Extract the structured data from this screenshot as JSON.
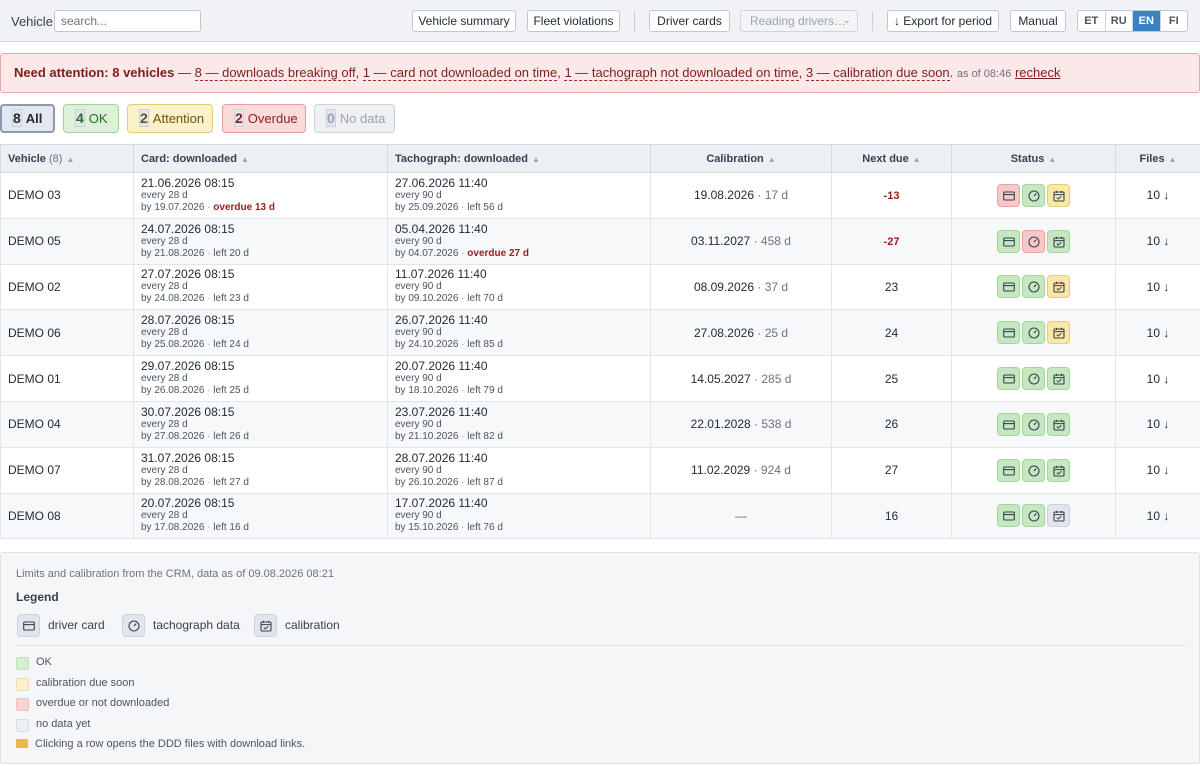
{
  "toolbar": {
    "vehicle_label": "Vehicle:",
    "search_placeholder": "search...",
    "vehicle_summary": "Vehicle summary",
    "fleet_violations": "Fleet violations",
    "driver_cards": "Driver cards",
    "reading_drivers": "Reading drivers…",
    "export": "↓ Export for period",
    "manual": "Manual",
    "languages": [
      {
        "code": "ET",
        "active": false
      },
      {
        "code": "RU",
        "active": false
      },
      {
        "code": "EN",
        "active": true
      },
      {
        "code": "FI",
        "active": false
      }
    ]
  },
  "alert": {
    "title": "Need attention: 8 vehicles",
    "dash": "—",
    "item1": "8 — downloads breaking off",
    "item2": "1 — card not downloaded on time",
    "item3": "1 — tachograph not downloaded on time",
    "item4": "3 — calibration due soon",
    "asof": "as of 08:46",
    "recheck": "recheck"
  },
  "filters": [
    {
      "count": "8",
      "label": "All",
      "kind": "all"
    },
    {
      "count": "4",
      "label": "OK",
      "kind": "ok"
    },
    {
      "count": "2",
      "label": "Attention",
      "kind": "attention"
    },
    {
      "count": "2",
      "label": "Overdue",
      "kind": "overdue"
    },
    {
      "count": "0",
      "label": "No data",
      "kind": "nodata"
    }
  ],
  "table": {
    "headers": {
      "vehicle": "Vehicle",
      "vehicle_count": "(8)",
      "card": "Card: downloaded",
      "tacho": "Tachograph: downloaded",
      "calibration": "Calibration",
      "next_due": "Next due",
      "status": "Status",
      "files": "Files"
    },
    "rows": [
      {
        "vehicle": "DEMO 03",
        "card": {
          "date": "21.06.2026 08:15",
          "every": "every 28 d",
          "by": "by 19.07.2026",
          "extra": "overdue 13 d",
          "overdue": true
        },
        "tacho": {
          "date": "27.06.2026 11:40",
          "every": "every 90 d",
          "by": "by 25.09.2026",
          "extra": "left 56 d",
          "overdue": false
        },
        "cal_date": "19.08.2026",
        "cal_days": "17 d",
        "next_due": "-13",
        "neg": true,
        "status": [
          "r",
          "g",
          "y"
        ],
        "files": "10 ↓"
      },
      {
        "vehicle": "DEMO 05",
        "card": {
          "date": "24.07.2026 08:15",
          "every": "every 28 d",
          "by": "by 21.08.2026",
          "extra": "left 20 d",
          "overdue": false
        },
        "tacho": {
          "date": "05.04.2026 11:40",
          "every": "every 90 d",
          "by": "by 04.07.2026",
          "extra": "overdue 27 d",
          "overdue": true
        },
        "cal_date": "03.11.2027",
        "cal_days": "458 d",
        "next_due": "-27",
        "neg": true,
        "status": [
          "g",
          "r",
          "g"
        ],
        "files": "10 ↓"
      },
      {
        "vehicle": "DEMO 02",
        "card": {
          "date": "27.07.2026 08:15",
          "every": "every 28 d",
          "by": "by 24.08.2026",
          "extra": "left 23 d",
          "overdue": false
        },
        "tacho": {
          "date": "11.07.2026 11:40",
          "every": "every 90 d",
          "by": "by 09.10.2026",
          "extra": "left 70 d",
          "overdue": false
        },
        "cal_date": "08.09.2026",
        "cal_days": "37 d",
        "next_due": "23",
        "neg": false,
        "status": [
          "g",
          "g",
          "y"
        ],
        "files": "10 ↓"
      },
      {
        "vehicle": "DEMO 06",
        "card": {
          "date": "28.07.2026 08:15",
          "every": "every 28 d",
          "by": "by 25.08.2026",
          "extra": "left 24 d",
          "overdue": false
        },
        "tacho": {
          "date": "26.07.2026 11:40",
          "every": "every 90 d",
          "by": "by 24.10.2026",
          "extra": "left 85 d",
          "overdue": false
        },
        "cal_date": "27.08.2026",
        "cal_days": "25 d",
        "next_due": "24",
        "neg": false,
        "status": [
          "g",
          "g",
          "y"
        ],
        "files": "10 ↓"
      },
      {
        "vehicle": "DEMO 01",
        "card": {
          "date": "29.07.2026 08:15",
          "every": "every 28 d",
          "by": "by 26.08.2026",
          "extra": "left 25 d",
          "overdue": false
        },
        "tacho": {
          "date": "20.07.2026 11:40",
          "every": "every 90 d",
          "by": "by 18.10.2026",
          "extra": "left 79 d",
          "overdue": false
        },
        "cal_date": "14.05.2027",
        "cal_days": "285 d",
        "next_due": "25",
        "neg": false,
        "status": [
          "g",
          "g",
          "g"
        ],
        "files": "10 ↓"
      },
      {
        "vehicle": "DEMO 04",
        "card": {
          "date": "30.07.2026 08:15",
          "every": "every 28 d",
          "by": "by 27.08.2026",
          "extra": "left 26 d",
          "overdue": false
        },
        "tacho": {
          "date": "23.07.2026 11:40",
          "every": "every 90 d",
          "by": "by 21.10.2026",
          "extra": "left 82 d",
          "overdue": false
        },
        "cal_date": "22.01.2028",
        "cal_days": "538 d",
        "next_due": "26",
        "neg": false,
        "status": [
          "g",
          "g",
          "g"
        ],
        "files": "10 ↓"
      },
      {
        "vehicle": "DEMO 07",
        "card": {
          "date": "31.07.2026 08:15",
          "every": "every 28 d",
          "by": "by 28.08.2026",
          "extra": "left 27 d",
          "overdue": false
        },
        "tacho": {
          "date": "28.07.2026 11:40",
          "every": "every 90 d",
          "by": "by 26.10.2026",
          "extra": "left 87 d",
          "overdue": false
        },
        "cal_date": "11.02.2029",
        "cal_days": "924 d",
        "next_due": "27",
        "neg": false,
        "status": [
          "g",
          "g",
          "g"
        ],
        "files": "10 ↓"
      },
      {
        "vehicle": "DEMO 08",
        "card": {
          "date": "20.07.2026 08:15",
          "every": "every 28 d",
          "by": "by 17.08.2026",
          "extra": "left 16 d",
          "overdue": false
        },
        "tacho": {
          "date": "17.07.2026 11:40",
          "every": "every 90 d",
          "by": "by 15.10.2026",
          "extra": "left 76 d",
          "overdue": false
        },
        "cal_date": "—",
        "cal_days": "",
        "next_due": "16",
        "neg": false,
        "status": [
          "g",
          "g",
          "n"
        ],
        "files": "10 ↓"
      }
    ]
  },
  "footer": {
    "note": "Limits and calibration from the CRM, data as of 09.08.2026 08:21",
    "legend_title": "Legend",
    "icons": [
      {
        "icon": "card-icon",
        "label": "driver card"
      },
      {
        "icon": "gauge-icon",
        "label": "tachograph data"
      },
      {
        "icon": "calendar-icon",
        "label": "calibration"
      }
    ],
    "swatches": [
      {
        "color": "#d6efd2",
        "label": "OK"
      },
      {
        "color": "#fcf1c4",
        "label": "calibration due soon"
      },
      {
        "color": "#f9d3d3",
        "label": "overdue or not downloaded"
      },
      {
        "color": "#eceff3",
        "label": "no data yet"
      }
    ],
    "hint": "Clicking a row opens the DDD files with download links."
  },
  "colors": {
    "ok": "#c5e8c0",
    "attention": "#fbe7a6",
    "overdue": "#f6c8c8",
    "nodata": "#e2e6ec",
    "accent": "#3b82c4"
  }
}
